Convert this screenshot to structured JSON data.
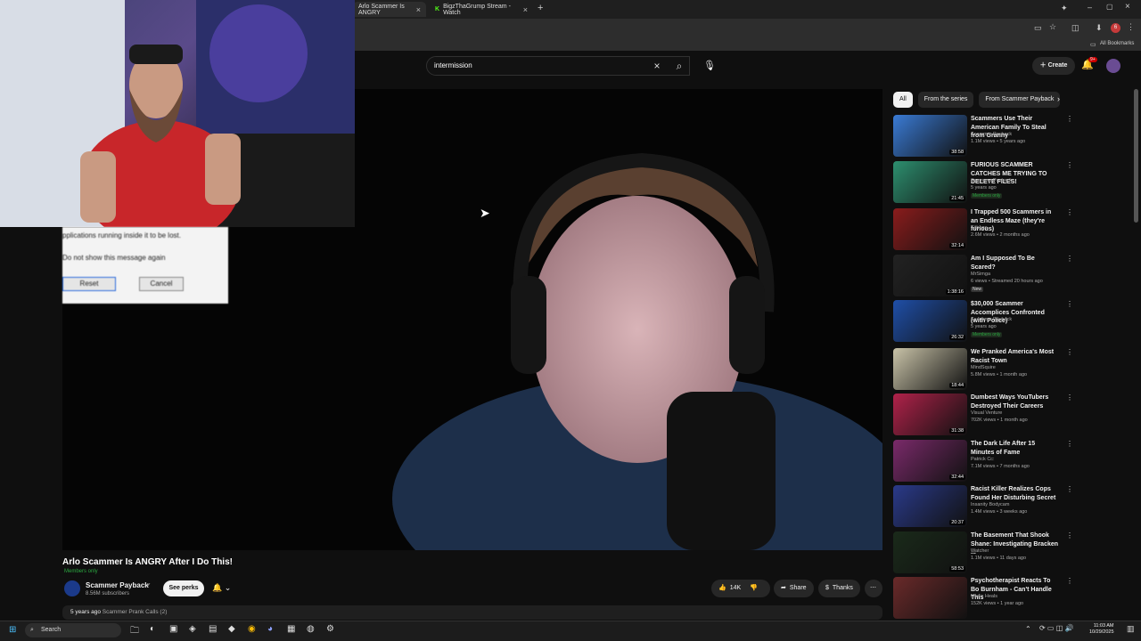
{
  "browser": {
    "tabs": [
      {
        "label": "Arlo Scammer Is ANGRY"
      },
      {
        "label": "BigzThaGrump Stream - Watch"
      }
    ],
    "bookmarks_label": "All Bookmarks",
    "profile_count": "6"
  },
  "youtube": {
    "search_value": "intermission",
    "create_label": "Create",
    "notif_badge": "9+"
  },
  "video": {
    "title": "Arlo Scammer Is ANGRY After I Do This!",
    "members_label": "Members only",
    "channel_name": "Scammer Payback",
    "channel_subs": "8.56M subscribers",
    "perks_label": "See perks",
    "like_count": "14K",
    "share_label": "Share",
    "thanks_label": "Thanks",
    "desc_meta": "5 years ago",
    "desc_tags": "Scammer Prank Calls (2)"
  },
  "overlay_dialog": {
    "line1": "pplications running inside it to be lost.",
    "checkbox": "Do not show this message again",
    "reset": "Reset",
    "cancel": "Cancel"
  },
  "chips": [
    "All",
    "From the series",
    "From Scammer Payback"
  ],
  "recommendations": [
    {
      "title": "Scammers Use Their American Family To Steal from Granny",
      "channel": "Scammer Payback",
      "meta": "1.1M views • 5 years ago",
      "duration": "38:58",
      "badge": "",
      "color": "#3a7bd5"
    },
    {
      "title": "FURIOUS SCAMMER CATCHES ME TRYING TO DELETE FILES!",
      "channel": "Scammer Payback",
      "meta": "5 years ago",
      "duration": "21:45",
      "badge": "Members only",
      "color": "#2d8f6f"
    },
    {
      "title": "I Trapped 500 Scammers in an Endless Maze (they're furious)",
      "channel": "Kitboga",
      "meta": "2.6M views • 2 months ago",
      "duration": "32:14",
      "badge": "",
      "color": "#8a1c1c"
    },
    {
      "title": "Am I Supposed To Be Scared?",
      "channel": "MrSimga",
      "meta": "6 views • Streamed 20 hours ago",
      "duration": "1:38:16",
      "badge": "New",
      "color": "#222"
    },
    {
      "title": "$30,000 Scammer Accomplices Confronted (with Police)",
      "channel": "Scammer Payback",
      "meta": "5 years ago",
      "duration": "26:32",
      "badge": "Members only",
      "color": "#1f4fa8"
    },
    {
      "title": "We Pranked America's Most Racist Town",
      "channel": "MindSquire",
      "meta": "5.8M views • 1 month ago",
      "duration": "18:44",
      "badge": "",
      "color": "#c9c3a8"
    },
    {
      "title": "Dumbest Ways YouTubers Destroyed Their Careers",
      "channel": "Visual Venture",
      "meta": "702K views • 1 month ago",
      "duration": "31:38",
      "badge": "",
      "color": "#b0224a"
    },
    {
      "title": "The Dark Life After 15 Minutes of Fame",
      "channel": "Patrick Cc:",
      "meta": "7.1M views • 7 months ago",
      "duration": "32:44",
      "badge": "",
      "color": "#7a2a6a"
    },
    {
      "title": "Racist Killer Realizes Cops Found Her Disturbing Secret",
      "channel": "Insanity Bodycam",
      "meta": "1.4M views • 3 weeks ago",
      "duration": "20:37",
      "badge": "",
      "color": "#2a3a8a"
    },
    {
      "title": "The Basement That Shook Shane: Investigating Bracken ...",
      "channel": "Watcher",
      "meta": "1.1M views • 11 days ago",
      "duration": "58:53",
      "badge": "",
      "color": "#1a2a1a"
    },
    {
      "title": "Psychotherapist Reacts To Bo Burnham - Can't Handle This",
      "channel": "Music Heals",
      "meta": "152K views • 1 year ago",
      "duration": "",
      "badge": "",
      "color": "#6a2a2a"
    }
  ],
  "taskbar": {
    "search_label": "Search",
    "time": "11:03 AM",
    "date": "10/29/2025"
  }
}
